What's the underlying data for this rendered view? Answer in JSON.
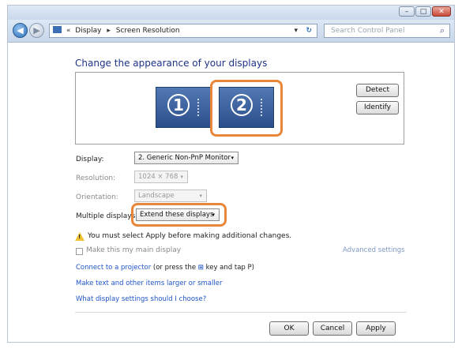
{
  "window_controls": {
    "minimize": "–",
    "maximize": "□",
    "close": "✕"
  },
  "nav": {
    "back_glyph": "◀",
    "forward_glyph": "▶",
    "breadcrumb": [
      "Display",
      "Screen Resolution"
    ],
    "breadcrumb_prefix": "«",
    "breadcrumb_sep": "▸",
    "dropdown_glyph": "▾",
    "refresh_glyph": "↻",
    "search_placeholder": "Search Control Panel",
    "search_glyph": "⌕"
  },
  "heading": "Change the appearance of your displays",
  "monitors": [
    {
      "number": "1",
      "selected": false
    },
    {
      "number": "2",
      "selected": true
    }
  ],
  "buttons": {
    "detect": "Detect",
    "identify": "Identify"
  },
  "settings": {
    "display": {
      "label": "Display:",
      "value": "2. Generic Non-PnP Monitor",
      "enabled": true
    },
    "resolution": {
      "label": "Resolution:",
      "value": "1024 × 768",
      "enabled": false
    },
    "orientation": {
      "label": "Orientation:",
      "value": "Landscape",
      "enabled": false
    },
    "multiple_displays": {
      "label": "Multiple displays:",
      "value": "Extend these displays",
      "enabled": true
    }
  },
  "warning": {
    "glyph": "!",
    "text": "You must select Apply before making additional changes."
  },
  "main_display_checkbox": {
    "label": "Make this my main display",
    "checked": false
  },
  "advanced_settings": "Advanced settings",
  "links": {
    "projector_link": "Connect to a projector",
    "projector_rest_1": " (or press the ",
    "windows_glyph": "⊞",
    "projector_rest_2": " key and tap P)",
    "text_size": "Make text and other items larger or smaller",
    "which_settings": "What display settings should I choose?"
  },
  "footer": {
    "ok": "OK",
    "cancel": "Cancel",
    "apply": "Apply"
  },
  "colors": {
    "highlight": "#e8873a",
    "link": "#1f55c7",
    "heading": "#1e3287",
    "monitor": "#2b4e8a"
  }
}
